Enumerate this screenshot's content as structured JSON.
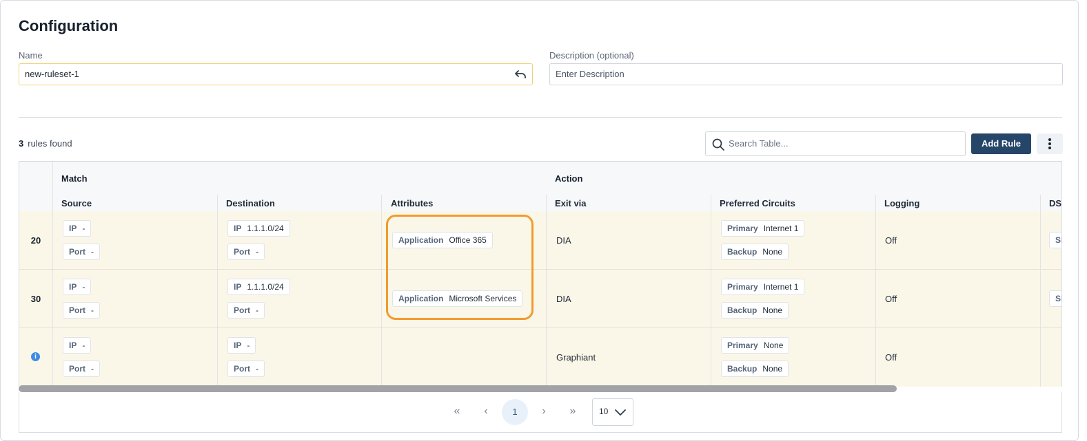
{
  "page": {
    "title": "Configuration"
  },
  "form": {
    "name_label": "Name",
    "name_value": "new-ruleset-1",
    "description_label": "Description (optional)",
    "description_placeholder": "Enter Description"
  },
  "toolbar": {
    "count": "3",
    "count_suffix": "rules found",
    "search_placeholder": "Search Table...",
    "add_rule_label": "Add Rule"
  },
  "table": {
    "groups": {
      "match": "Match",
      "action": "Action"
    },
    "columns": {
      "source": "Source",
      "destination": "Destination",
      "attributes": "Attributes",
      "exit_via": "Exit via",
      "preferred_circuits": "Preferred Circuits",
      "logging": "Logging",
      "dscp": "DSC"
    },
    "rows": [
      {
        "num": "20",
        "src_ip_k": "IP",
        "src_ip_v": "-",
        "src_port_k": "Port",
        "src_port_v": "-",
        "dst_ip_k": "IP",
        "dst_ip_v": "1.1.1.0/24",
        "dst_port_k": "Port",
        "dst_port_v": "-",
        "attr_k": "Application",
        "attr_v": "Office 365",
        "exit": "DIA",
        "primary_k": "Primary",
        "primary_v": "Internet 1",
        "backup_k": "Backup",
        "backup_v": "None",
        "logging": "Off",
        "dscp": "SL"
      },
      {
        "num": "30",
        "src_ip_k": "IP",
        "src_ip_v": "-",
        "src_port_k": "Port",
        "src_port_v": "-",
        "dst_ip_k": "IP",
        "dst_ip_v": "1.1.1.0/24",
        "dst_port_k": "Port",
        "dst_port_v": "-",
        "attr_k": "Application",
        "attr_v": "Microsoft Services",
        "exit": "DIA",
        "primary_k": "Primary",
        "primary_v": "Internet 1",
        "backup_k": "Backup",
        "backup_v": "None",
        "logging": "Off",
        "dscp": "SL"
      },
      {
        "num_icon": "i",
        "src_ip_k": "IP",
        "src_ip_v": "-",
        "src_port_k": "Port",
        "src_port_v": "-",
        "dst_ip_k": "IP",
        "dst_ip_v": "-",
        "dst_port_k": "Port",
        "dst_port_v": "-",
        "exit": "Graphiant",
        "primary_k": "Primary",
        "primary_v": "None",
        "backup_k": "Backup",
        "backup_v": "None",
        "logging": "Off"
      }
    ]
  },
  "pagination": {
    "first": "«",
    "prev": "‹",
    "current": "1",
    "next": "›",
    "last": "»",
    "page_size": "10"
  },
  "colors": {
    "accent": "#254669",
    "highlight": "#f29a2e",
    "row_bg": "#fbf7e8"
  }
}
